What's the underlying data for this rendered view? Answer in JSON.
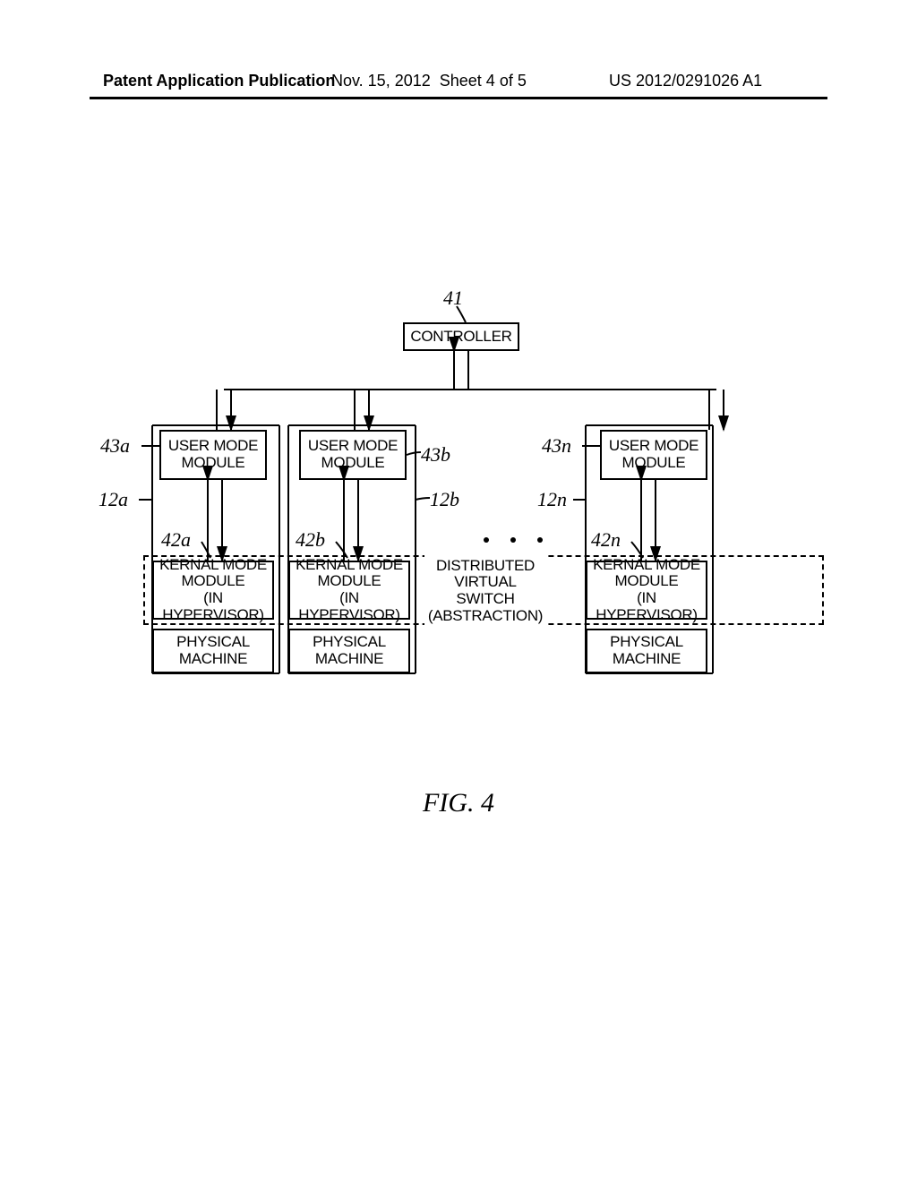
{
  "header": {
    "left": "Patent Application Publication",
    "date": "Nov. 15, 2012",
    "sheet": "Sheet 4 of 5",
    "docnum": "US 2012/0291026 A1"
  },
  "diagram": {
    "controller": {
      "text": "CONTROLLER",
      "ref": "41"
    },
    "columns": {
      "a": {
        "user": {
          "l1": "USER MODE",
          "l2": "MODULE",
          "ref": "43a"
        },
        "midref": "12a",
        "kernref": "42a",
        "kernel": {
          "l1": "KERNAL MODE",
          "l2": "MODULE",
          "l3": "(IN HYPERVISOR)"
        },
        "phys": {
          "l1": "PHYSICAL",
          "l2": "MACHINE"
        }
      },
      "b": {
        "user": {
          "l1": "USER MODE",
          "l2": "MODULE",
          "ref": "43b"
        },
        "midref": "12b",
        "kernref": "42b",
        "kernel": {
          "l1": "KERNAL MODE",
          "l2": "MODULE",
          "l3": "(IN HYPERVISOR)"
        },
        "phys": {
          "l1": "PHYSICAL",
          "l2": "MACHINE"
        }
      },
      "n": {
        "user": {
          "l1": "USER MODE",
          "l2": "MODULE",
          "ref": "43n"
        },
        "midref": "12n",
        "kernref": "42n",
        "kernel": {
          "l1": "KERNAL MODE",
          "l2": "MODULE",
          "l3": "(IN HYPERVISOR)"
        },
        "phys": {
          "l1": "PHYSICAL",
          "l2": "MACHINE"
        }
      }
    },
    "dvs": {
      "l1": "DISTRIBUTED",
      "l2": "VIRTUAL",
      "l3": "SWITCH",
      "l4": "(ABSTRACTION)"
    }
  },
  "caption": "FIG. 4"
}
